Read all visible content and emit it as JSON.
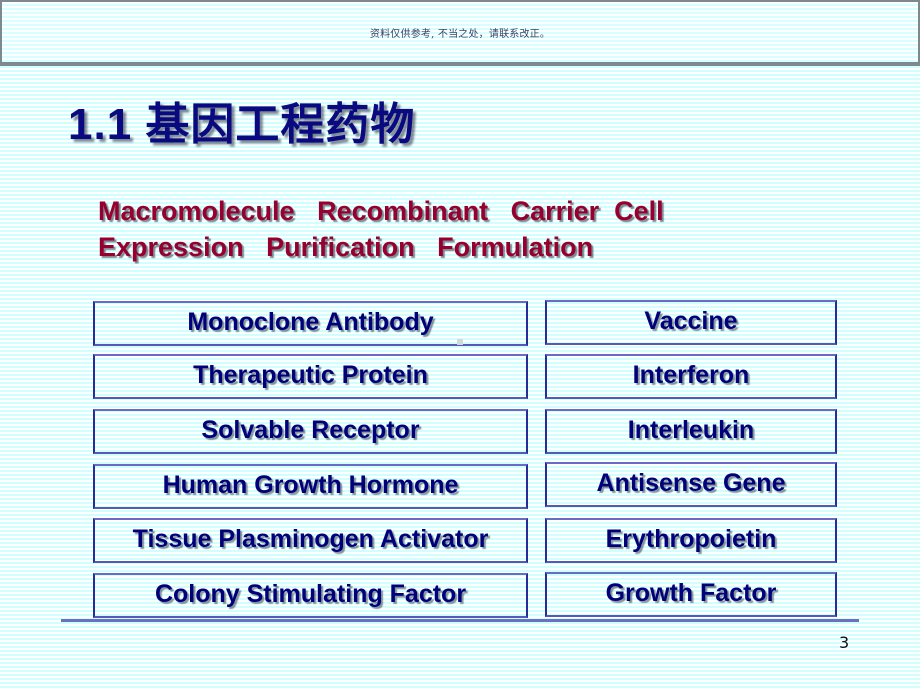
{
  "notice": {
    "text": "资料仅供参考, 不当之处，请联系改正。"
  },
  "slide": {
    "title": "1.1 基因工程药物",
    "keywords": {
      "line1": "Macromolecule   Recombinant   Carrier  Cell",
      "line2": "Expression   Purification   Formulation"
    },
    "left_column": [
      {
        "label": "Monoclone Antibody"
      },
      {
        "label": "Therapeutic Protein"
      },
      {
        "label": "Solvable Receptor"
      },
      {
        "label": "Human Growth Hormone"
      },
      {
        "label": "Tissue Plasminogen Activator"
      },
      {
        "label": "Colony Stimulating Factor"
      }
    ],
    "right_column": [
      {
        "label": "Vaccine"
      },
      {
        "label": "Interferon"
      },
      {
        "label": "Interleukin"
      },
      {
        "label": "Antisense Gene"
      },
      {
        "label": "Erythropoietin"
      },
      {
        "label": "Growth Factor"
      }
    ],
    "page_number": "3"
  },
  "colors": {
    "title": "#0a0a80",
    "keywords": "#96002e",
    "term_text": "#00007a",
    "box_border": "#2a2a9a",
    "stripe": "#cfffff",
    "rule": "#6c70c0"
  }
}
